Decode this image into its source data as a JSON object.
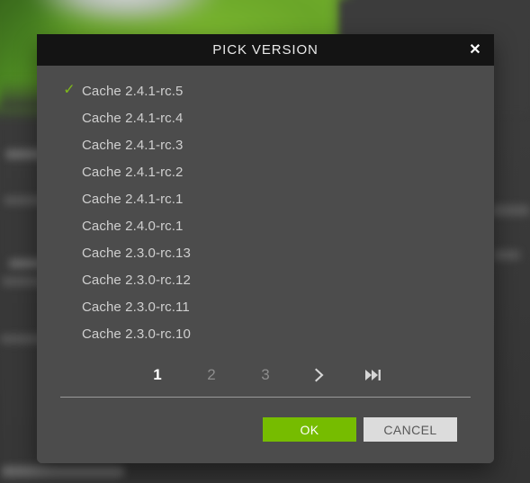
{
  "dialog": {
    "title": "PICK VERSION",
    "close_icon": "close-icon",
    "close_glyph": "✕"
  },
  "versions": [
    {
      "label": "Cache 2.4.1-rc.5",
      "selected": true
    },
    {
      "label": "Cache 2.4.1-rc.4",
      "selected": false
    },
    {
      "label": "Cache 2.4.1-rc.3",
      "selected": false
    },
    {
      "label": "Cache 2.4.1-rc.2",
      "selected": false
    },
    {
      "label": "Cache 2.4.1-rc.1",
      "selected": false
    },
    {
      "label": "Cache 2.4.0-rc.1",
      "selected": false
    },
    {
      "label": "Cache 2.3.0-rc.13",
      "selected": false
    },
    {
      "label": "Cache 2.3.0-rc.12",
      "selected": false
    },
    {
      "label": "Cache 2.3.0-rc.11",
      "selected": false
    },
    {
      "label": "Cache 2.3.0-rc.10",
      "selected": false
    }
  ],
  "check_glyph": "✓",
  "pagination": {
    "pages": [
      {
        "label": "1",
        "active": true
      },
      {
        "label": "2",
        "active": false
      },
      {
        "label": "3",
        "active": false
      }
    ],
    "next_icon": "chevron-right-icon",
    "last_icon": "skip-to-end-icon"
  },
  "actions": {
    "ok_label": "OK",
    "cancel_label": "CANCEL"
  },
  "colors": {
    "accent_green": "#76bc00",
    "check_green": "#7fba1a",
    "titlebar": "#141414",
    "dialog_body": "#4c4c4c",
    "cancel_bg": "#dcdcdc",
    "text_primary": "#cfcfcf",
    "text_dim": "#8d8d8d"
  }
}
